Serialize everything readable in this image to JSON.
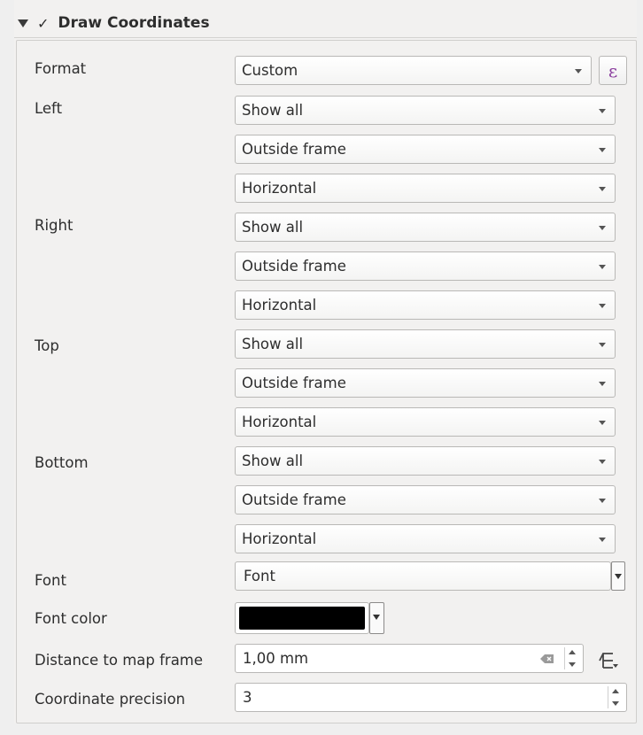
{
  "group": {
    "title": "Draw Coordinates",
    "checked": true
  },
  "labels": {
    "format": "Format",
    "left": "Left",
    "right": "Right",
    "top": "Top",
    "bottom": "Bottom",
    "font": "Font",
    "font_color": "Font color",
    "distance": "Distance to map frame",
    "precision": "Coordinate precision"
  },
  "format": {
    "value": "Custom",
    "expression_icon": "ε"
  },
  "sides": {
    "left": {
      "display": "Show all",
      "position": "Outside frame",
      "direction": "Horizontal"
    },
    "right": {
      "display": "Show all",
      "position": "Outside frame",
      "direction": "Horizontal"
    },
    "top": {
      "display": "Show all",
      "position": "Outside frame",
      "direction": "Horizontal"
    },
    "bottom": {
      "display": "Show all",
      "position": "Outside frame",
      "direction": "Horizontal"
    }
  },
  "font_button": "Font",
  "font_color": "#000000",
  "distance": {
    "value": "1,00 mm"
  },
  "precision": {
    "value": "3"
  },
  "icons": {
    "collapse": "collapse-arrow-icon",
    "checkbox": "checkbox-icon",
    "expression": "expression-icon",
    "dropdown": "chevron-down-icon",
    "clear": "clear-icon",
    "unit": "data-defined-override-icon"
  }
}
